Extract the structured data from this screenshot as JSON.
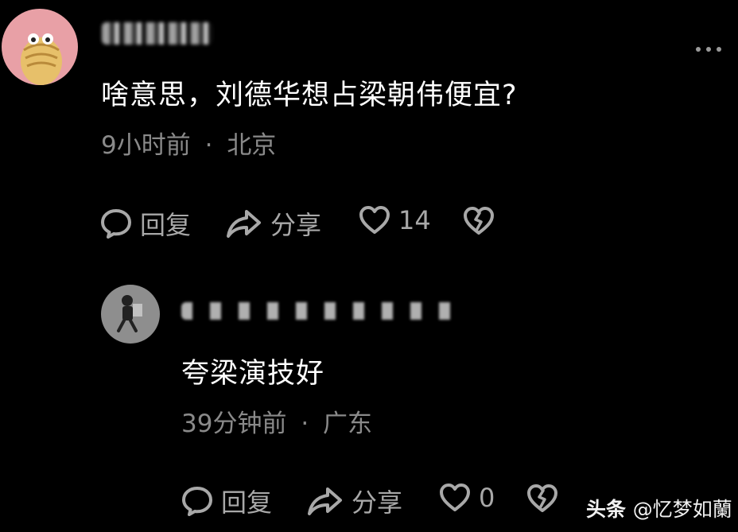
{
  "comment": {
    "text": "啥意思，刘德华想占梁朝伟便宜?",
    "time": "9小时前",
    "separator": "·",
    "location": "北京",
    "reply_label": "回复",
    "share_label": "分享",
    "like_count": "14",
    "icons": [
      "comment-bubble-icon",
      "share-arrow-icon",
      "heart-icon",
      "broken-heart-icon",
      "more-dots-icon"
    ]
  },
  "reply": {
    "text": "夸梁演技好",
    "time": "39分钟前",
    "separator": "·",
    "location": "广东",
    "reply_label": "回复",
    "share_label": "分享",
    "like_count": "0"
  },
  "watermark": {
    "brand": "头条",
    "handle": "@忆梦如蘭"
  },
  "colors": {
    "background": "#000000",
    "text": "#ffffff",
    "meta": "#8a8a8a",
    "action": "#a8a8a8",
    "avatar1_bg": "#e8a0a6",
    "avatar2_bg": "#8e8e8e"
  }
}
